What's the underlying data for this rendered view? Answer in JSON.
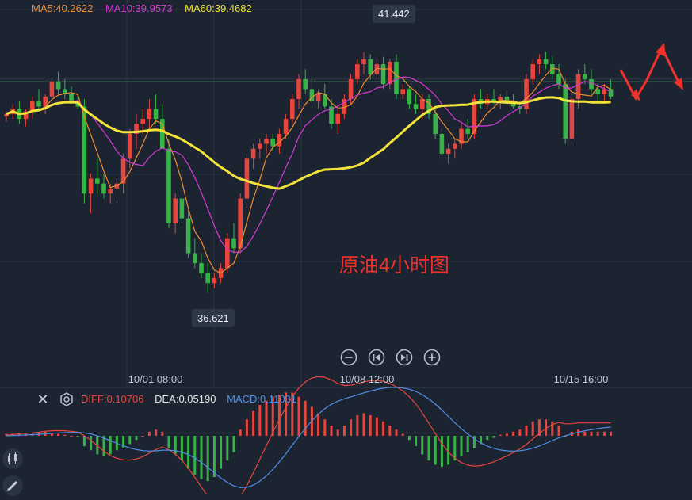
{
  "ma_legend": {
    "ma5": "MA5:40.2622",
    "ma10": "MA10:39.9573",
    "ma60": "MA60:39.4682"
  },
  "macd_legend": {
    "diff": "DIFF:0.10706",
    "dea": "DEA:0.05190",
    "macd": "MACD:0.11031"
  },
  "annotations": {
    "high": "41.442",
    "low": "36.621",
    "title": "原油4小时图"
  },
  "x_ticks": [
    "10/01 08:00",
    "10/08 12:00",
    "10/15 16:00"
  ],
  "colors": {
    "background": "#1c2331",
    "up": "#e8463c",
    "down": "#36b546",
    "ma5": "#f08c2e",
    "ma10": "#d63ad6",
    "ma60": "#f2e33a",
    "diff": "#e8463c",
    "dea": "#4f8fe8",
    "arrow": "#f0322c"
  },
  "icons": {
    "close": "close-icon",
    "settings": "settings-icon",
    "zoom_out": "minus-circle-icon",
    "prev": "skip-back-icon",
    "next": "skip-forward-icon",
    "zoom_in": "plus-circle-icon",
    "candles": "candlestick-icon",
    "draw": "pencil-icon"
  },
  "chart_data": {
    "type": "candlestick",
    "title": "原油4小时图",
    "high": 41.442,
    "low": 36.621,
    "ylim": [
      35.8,
      42.3
    ],
    "x_ticks": [
      "10/01 08:00",
      "10/08 12:00",
      "10/15 16:00"
    ],
    "ohlc": [
      [
        40.15,
        40.25,
        40.05,
        40.2
      ],
      [
        40.2,
        40.4,
        40.1,
        40.3
      ],
      [
        40.3,
        40.45,
        40.0,
        40.1
      ],
      [
        40.1,
        40.3,
        39.95,
        40.25
      ],
      [
        40.25,
        40.55,
        40.1,
        40.45
      ],
      [
        40.45,
        40.7,
        40.3,
        40.35
      ],
      [
        40.35,
        40.6,
        40.2,
        40.55
      ],
      [
        40.55,
        40.95,
        40.4,
        40.85
      ],
      [
        40.85,
        41.05,
        40.6,
        40.7
      ],
      [
        40.7,
        40.9,
        40.5,
        40.6
      ],
      [
        40.6,
        40.75,
        40.4,
        40.45
      ],
      [
        40.45,
        40.6,
        40.3,
        40.35
      ],
      [
        40.35,
        40.5,
        38.4,
        38.6
      ],
      [
        38.6,
        39.0,
        38.2,
        38.9
      ],
      [
        38.9,
        39.3,
        38.6,
        38.8
      ],
      [
        38.8,
        39.0,
        38.5,
        38.6
      ],
      [
        38.6,
        38.8,
        38.4,
        38.7
      ],
      [
        38.7,
        38.9,
        38.5,
        38.8
      ],
      [
        38.8,
        39.4,
        38.6,
        39.3
      ],
      [
        39.3,
        39.9,
        39.1,
        39.8
      ],
      [
        39.8,
        40.2,
        39.5,
        40.0
      ],
      [
        40.0,
        40.3,
        39.8,
        40.1
      ],
      [
        40.1,
        40.5,
        39.9,
        40.3
      ],
      [
        40.3,
        40.6,
        40.0,
        40.1
      ],
      [
        40.1,
        40.4,
        39.8,
        39.5
      ],
      [
        39.5,
        39.7,
        37.9,
        38.0
      ],
      [
        38.0,
        38.6,
        37.8,
        38.5
      ],
      [
        38.5,
        38.7,
        38.0,
        38.1
      ],
      [
        38.1,
        38.3,
        37.3,
        37.4
      ],
      [
        37.4,
        37.7,
        37.1,
        37.2
      ],
      [
        37.2,
        37.4,
        36.9,
        37.0
      ],
      [
        37.0,
        37.2,
        36.621,
        36.8
      ],
      [
        36.8,
        37.0,
        36.7,
        36.9
      ],
      [
        36.9,
        37.2,
        36.8,
        37.1
      ],
      [
        37.1,
        37.8,
        37.0,
        37.7
      ],
      [
        37.7,
        38.0,
        37.4,
        37.5
      ],
      [
        37.5,
        38.6,
        37.4,
        38.5
      ],
      [
        38.5,
        39.4,
        38.3,
        39.3
      ],
      [
        39.3,
        39.6,
        39.1,
        39.5
      ],
      [
        39.5,
        39.7,
        39.3,
        39.6
      ],
      [
        39.6,
        39.8,
        39.4,
        39.7
      ],
      [
        39.7,
        39.8,
        39.45,
        39.55
      ],
      [
        39.55,
        39.9,
        39.4,
        39.8
      ],
      [
        39.8,
        40.2,
        39.7,
        40.1
      ],
      [
        40.1,
        40.6,
        40.0,
        40.5
      ],
      [
        40.5,
        41.0,
        40.3,
        40.9
      ],
      [
        40.9,
        41.1,
        40.6,
        40.7
      ],
      [
        40.7,
        40.9,
        40.4,
        40.45
      ],
      [
        40.45,
        40.7,
        40.3,
        40.6
      ],
      [
        40.6,
        40.8,
        40.3,
        40.35
      ],
      [
        40.35,
        40.5,
        39.9,
        40.0
      ],
      [
        40.0,
        40.3,
        39.8,
        40.2
      ],
      [
        40.2,
        40.6,
        40.1,
        40.5
      ],
      [
        40.5,
        41.0,
        40.4,
        40.9
      ],
      [
        40.9,
        41.3,
        40.8,
        41.2
      ],
      [
        41.2,
        41.442,
        41.0,
        41.3
      ],
      [
        41.3,
        41.4,
        40.9,
        41.0
      ],
      [
        41.0,
        41.3,
        40.9,
        41.2
      ],
      [
        41.2,
        41.35,
        40.7,
        40.8
      ],
      [
        40.8,
        41.3,
        40.7,
        41.25
      ],
      [
        41.25,
        41.4,
        40.5,
        40.6
      ],
      [
        40.6,
        40.8,
        40.5,
        40.7
      ],
      [
        40.7,
        40.75,
        40.3,
        40.4
      ],
      [
        40.4,
        40.6,
        40.2,
        40.3
      ],
      [
        40.3,
        40.6,
        40.1,
        40.5
      ],
      [
        40.5,
        40.6,
        40.1,
        40.2
      ],
      [
        40.2,
        40.3,
        39.7,
        39.8
      ],
      [
        39.8,
        39.9,
        39.3,
        39.4
      ],
      [
        39.4,
        39.6,
        39.2,
        39.5
      ],
      [
        39.5,
        39.7,
        39.3,
        39.6
      ],
      [
        39.6,
        40.0,
        39.5,
        39.9
      ],
      [
        39.9,
        40.1,
        39.7,
        39.8
      ],
      [
        39.8,
        40.6,
        39.7,
        40.5
      ],
      [
        40.5,
        40.7,
        40.3,
        40.4
      ],
      [
        40.4,
        40.6,
        40.3,
        40.5
      ],
      [
        40.5,
        40.7,
        40.4,
        40.45
      ],
      [
        40.45,
        40.6,
        40.3,
        40.55
      ],
      [
        40.55,
        40.7,
        40.4,
        40.45
      ],
      [
        40.45,
        40.6,
        40.3,
        40.35
      ],
      [
        40.35,
        40.45,
        40.2,
        40.3
      ],
      [
        40.3,
        41.0,
        40.2,
        40.9
      ],
      [
        40.9,
        41.3,
        40.8,
        41.2
      ],
      [
        41.2,
        41.4,
        41.0,
        41.3
      ],
      [
        41.3,
        41.45,
        41.1,
        41.2
      ],
      [
        41.2,
        41.35,
        40.9,
        41.0
      ],
      [
        41.0,
        41.2,
        40.7,
        40.8
      ],
      [
        40.8,
        40.9,
        39.6,
        39.7
      ],
      [
        39.7,
        40.6,
        39.6,
        40.5
      ],
      [
        40.5,
        41.1,
        40.3,
        41.0
      ],
      [
        41.0,
        41.2,
        40.8,
        40.9
      ],
      [
        40.9,
        41.1,
        40.6,
        40.7
      ],
      [
        40.7,
        40.8,
        40.45,
        40.6
      ],
      [
        40.6,
        40.8,
        40.4,
        40.7
      ],
      [
        40.7,
        40.9,
        40.5,
        40.55
      ]
    ],
    "macd_hist": [
      0.01,
      0.01,
      0.015,
      0.01,
      0.01,
      0.015,
      0.02,
      0.015,
      0.01,
      0.005,
      0.0,
      -0.005,
      -0.05,
      -0.07,
      -0.09,
      -0.1,
      -0.09,
      -0.07,
      -0.06,
      -0.04,
      -0.02,
      0.0,
      0.02,
      0.03,
      0.02,
      -0.06,
      -0.09,
      -0.12,
      -0.16,
      -0.19,
      -0.21,
      -0.22,
      -0.2,
      -0.16,
      -0.12,
      -0.08,
      0.03,
      0.08,
      0.12,
      0.15,
      0.17,
      0.19,
      0.2,
      0.21,
      0.21,
      0.19,
      0.17,
      0.14,
      0.11,
      0.08,
      0.05,
      0.03,
      0.05,
      0.08,
      0.1,
      0.11,
      0.1,
      0.09,
      0.07,
      0.05,
      0.03,
      0.01,
      -0.02,
      -0.05,
      -0.09,
      -0.12,
      -0.14,
      -0.15,
      -0.14,
      -0.12,
      -0.1,
      -0.08,
      -0.06,
      -0.04,
      -0.02,
      -0.01,
      0.005,
      0.01,
      0.02,
      0.03,
      0.05,
      0.07,
      0.08,
      0.08,
      0.07,
      0.05,
      0.0,
      0.02,
      0.03,
      0.02,
      0.02,
      0.02,
      0.02,
      0.02
    ]
  }
}
